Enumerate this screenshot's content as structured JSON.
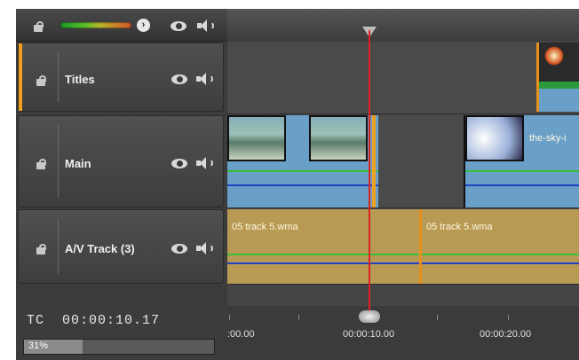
{
  "header": {
    "lock_icon": "lock-open-icon",
    "meter_icon": "audio-level-meter",
    "expand_icon": "chevron-right-icon",
    "expand_glyph": "›",
    "visibility_icon": "eye-icon",
    "audio_icon": "speaker-icon"
  },
  "tracks": [
    {
      "name": "Titles",
      "accent_color": "#f0a020"
    },
    {
      "name": "Main",
      "accent_color": "#f0a020"
    },
    {
      "name": "A/V Track (3)",
      "accent_color": "#f0a020"
    }
  ],
  "timecode": {
    "label": "TC",
    "value": "00:00:10.17"
  },
  "progress": {
    "percent_label": "31%",
    "fraction": 0.31
  },
  "clips": {
    "main_video_2": {
      "label": "the-sky-i"
    },
    "audio_1": {
      "label": "05 track 5.wma"
    },
    "audio_2": {
      "label": "05 track 5.wma"
    }
  },
  "ruler": {
    "labels": [
      ":00.00",
      "00:00:10.00",
      "00:00:20.00"
    ]
  },
  "colors": {
    "audio_clip": "#b89a55",
    "video_clip": "#6aa0c8",
    "playhead": "#d82424",
    "clip_accent": "#e6901e"
  }
}
